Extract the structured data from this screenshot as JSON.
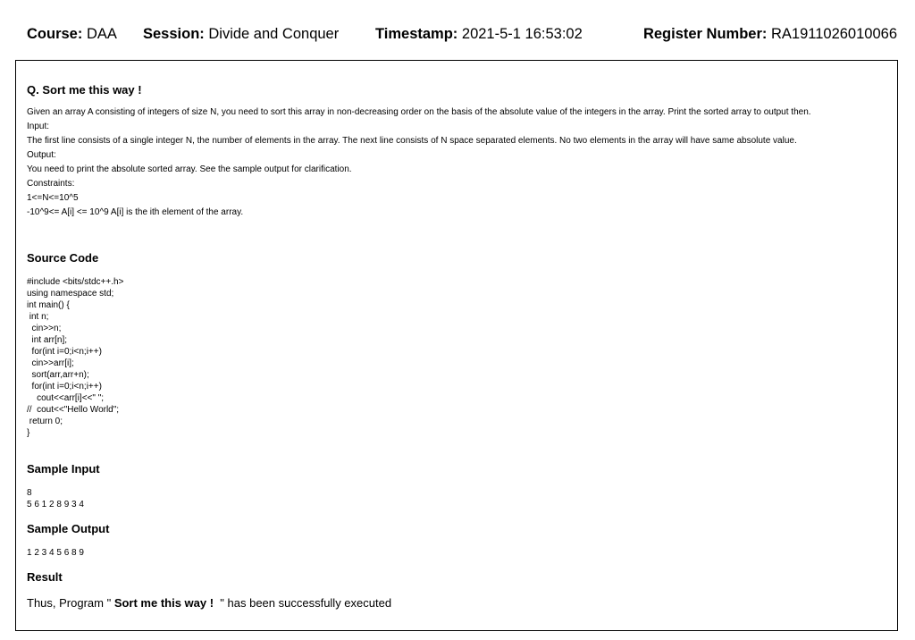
{
  "header": {
    "course_label": "Course:",
    "course_value": "DAA",
    "session_label": "Session:",
    "session_value": "Divide and Conquer",
    "timestamp_label": "Timestamp:",
    "timestamp_value": "2021-5-1 16:53:02",
    "register_label": "Register Number:",
    "register_value": "RA1911026010066"
  },
  "question": {
    "title": "Q. Sort me this way !",
    "lines": [
      "Given an array A consisting of integers of size N, you need to sort this array in non-decreasing order on the basis of the absolute value of the integers in the array. Print the sorted array to output then.",
      "Input:",
      "The first line consists of a single integer N, the number of elements in the array. The next line consists of N space separated elements. No two elements in the array will have same absolute value.",
      "Output:",
      "You need to print the absolute sorted array. See the sample output for clarification.",
      "Constraints:",
      "1<=N<=10^5",
      "-10^9<= A[i] <= 10^9 A[i] is the ith element of the array."
    ]
  },
  "source_code": {
    "title": "Source Code",
    "lines": [
      "#include <bits/stdc++.h>",
      "using namespace std;",
      "int main() {",
      " int n;",
      "  cin>>n;",
      "  int arr[n];",
      "  for(int i=0;i<n;i++)",
      "  cin>>arr[i];",
      "  sort(arr,arr+n);",
      "  for(int i=0;i<n;i++)",
      "    cout<<arr[i]<<\" \";",
      "//  cout<<\"Hello World\";",
      " return 0;",
      "}"
    ]
  },
  "sample_input": {
    "title": "Sample Input",
    "lines": [
      "8",
      "5 6 1 2 8 9 3 4"
    ]
  },
  "sample_output": {
    "title": "Sample Output",
    "lines": [
      "1 2 3 4 5 6 8 9"
    ]
  },
  "result": {
    "title": "Result",
    "prefix": "Thus, Program \" ",
    "program_name": "Sort me this way !",
    "suffix": "  \" has been successfully executed"
  }
}
